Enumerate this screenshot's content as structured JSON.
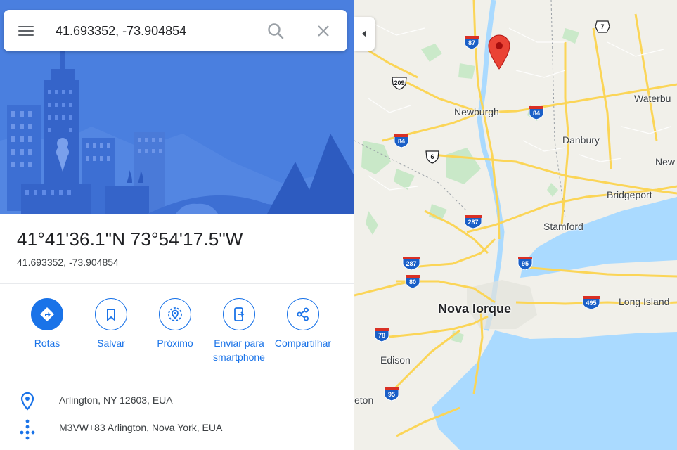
{
  "search": {
    "value": "41.693352, -73.904854"
  },
  "place": {
    "title": "41°41'36.1\"N 73°54'17.5\"W",
    "decimal": "41.693352, -73.904854"
  },
  "actions": [
    {
      "label": "Rotas",
      "icon": "directions-icon"
    },
    {
      "label": "Salvar",
      "icon": "bookmark-icon"
    },
    {
      "label": "Próximo",
      "icon": "nearby-icon"
    },
    {
      "label": "Enviar para smartphone",
      "icon": "send-to-phone-icon"
    },
    {
      "label": "Compartilhar",
      "icon": "share-icon"
    }
  ],
  "info": [
    {
      "text": "Arlington, NY 12603, EUA",
      "icon": "location-pin-icon"
    },
    {
      "text": "M3VW+83 Arlington, Nova York, EUA",
      "icon": "plus-code-icon"
    }
  ],
  "map": {
    "labels": {
      "newburgh": "Newburgh",
      "danbury": "Danbury",
      "waterbury": "Waterbu",
      "new": "New",
      "bridgeport": "Bridgeport",
      "stamford": "Stamford",
      "nova_iorque": "Nova Iorque",
      "long_island": "Long Island",
      "edison": "Edison",
      "trenton": "eton"
    },
    "shields": {
      "i87": "87",
      "us209": "209",
      "i84a": "84",
      "i84b": "84",
      "us6": "6",
      "i287a": "287",
      "i287b": "287",
      "i95a": "95",
      "i80": "80",
      "i495": "495",
      "i78": "78",
      "i95b": "95",
      "st7": "7"
    },
    "colors": {
      "water": "#aadaff",
      "land": "#f1f0ea",
      "park": "#c5e8c5",
      "highway": "#fbd557",
      "pin": "#ea4335"
    }
  },
  "colors": {
    "accent": "#1a73e8",
    "hero": "#4a7fdf"
  }
}
